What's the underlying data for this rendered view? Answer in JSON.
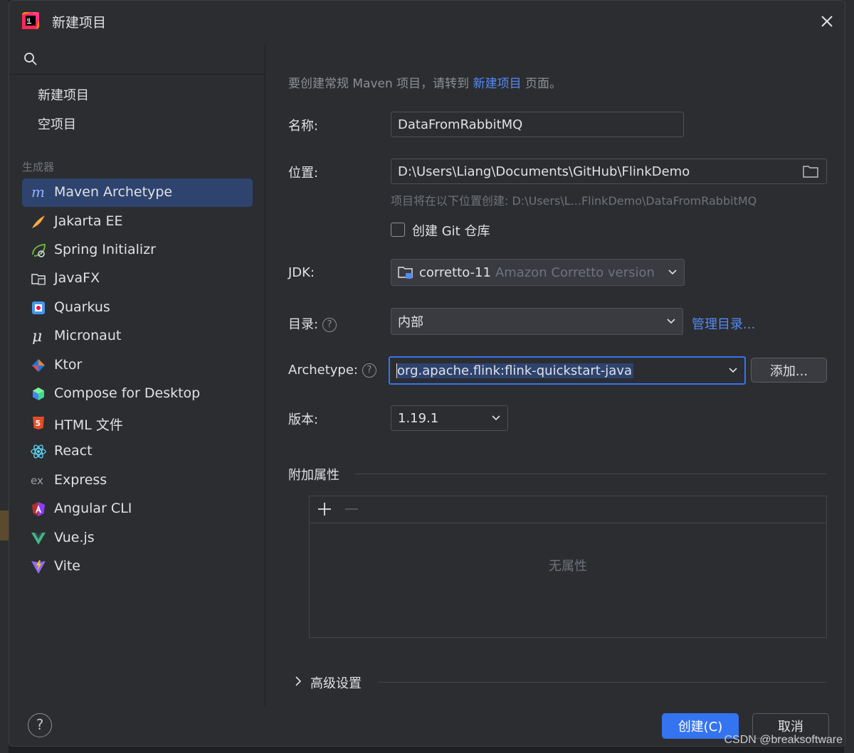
{
  "window": {
    "title": "新建项目"
  },
  "sidebar": {
    "top_items": [
      {
        "label": "新建项目"
      },
      {
        "label": "空项目"
      }
    ],
    "section_label": "生成器",
    "generators": [
      {
        "label": "Maven Archetype",
        "icon": "maven-icon",
        "selected": true
      },
      {
        "label": "Jakarta EE",
        "icon": "jakarta-icon"
      },
      {
        "label": "Spring Initializr",
        "icon": "spring-icon"
      },
      {
        "label": "JavaFX",
        "icon": "javafx-folder-icon"
      },
      {
        "label": "Quarkus",
        "icon": "quarkus-icon"
      },
      {
        "label": "Micronaut",
        "icon": "micronaut-icon"
      },
      {
        "label": "Ktor",
        "icon": "ktor-icon"
      },
      {
        "label": "Compose for Desktop",
        "icon": "compose-icon"
      },
      {
        "label": "HTML 文件",
        "icon": "html5-icon"
      },
      {
        "label": "React",
        "icon": "react-icon"
      },
      {
        "label": "Express",
        "icon": "express-icon"
      },
      {
        "label": "Angular CLI",
        "icon": "angular-icon"
      },
      {
        "label": "Vue.js",
        "icon": "vue-icon"
      },
      {
        "label": "Vite",
        "icon": "vite-icon"
      }
    ]
  },
  "form": {
    "hint_prefix": "要创建常规 Maven 项目，请转到",
    "hint_link": "新建项目",
    "hint_suffix": "页面。",
    "name_label": "名称:",
    "name_value": "DataFromRabbitMQ",
    "location_label": "位置:",
    "location_value": "D:\\Users\\Liang\\Documents\\GitHub\\FlinkDemo",
    "location_note": "项目将在以下位置创建: D:\\Users\\L...FlinkDemo\\DataFromRabbitMQ",
    "git_label": "创建 Git 仓库",
    "git_checked": false,
    "jdk_label": "JDK:",
    "jdk_value": "corretto-11",
    "jdk_detail": "Amazon Corretto version",
    "catalog_label": "目录:",
    "catalog_value": "内部",
    "manage_catalogs": "管理目录...",
    "archetype_label": "Archetype:",
    "archetype_value": "org.apache.flink:flink-quickstart-java",
    "add_button": "添加...",
    "version_label": "版本:",
    "version_value": "1.19.1",
    "props_title": "附加属性",
    "props_empty": "无属性",
    "advanced_label": "高级设置"
  },
  "footer": {
    "help": "?",
    "create": "创建(C)",
    "cancel": "取消"
  },
  "watermark": "CSDN @breaksoftware",
  "colors": {
    "background": "#2b2d30",
    "accent": "#3574f0",
    "link": "#548af7",
    "selection": "#2e436e"
  }
}
